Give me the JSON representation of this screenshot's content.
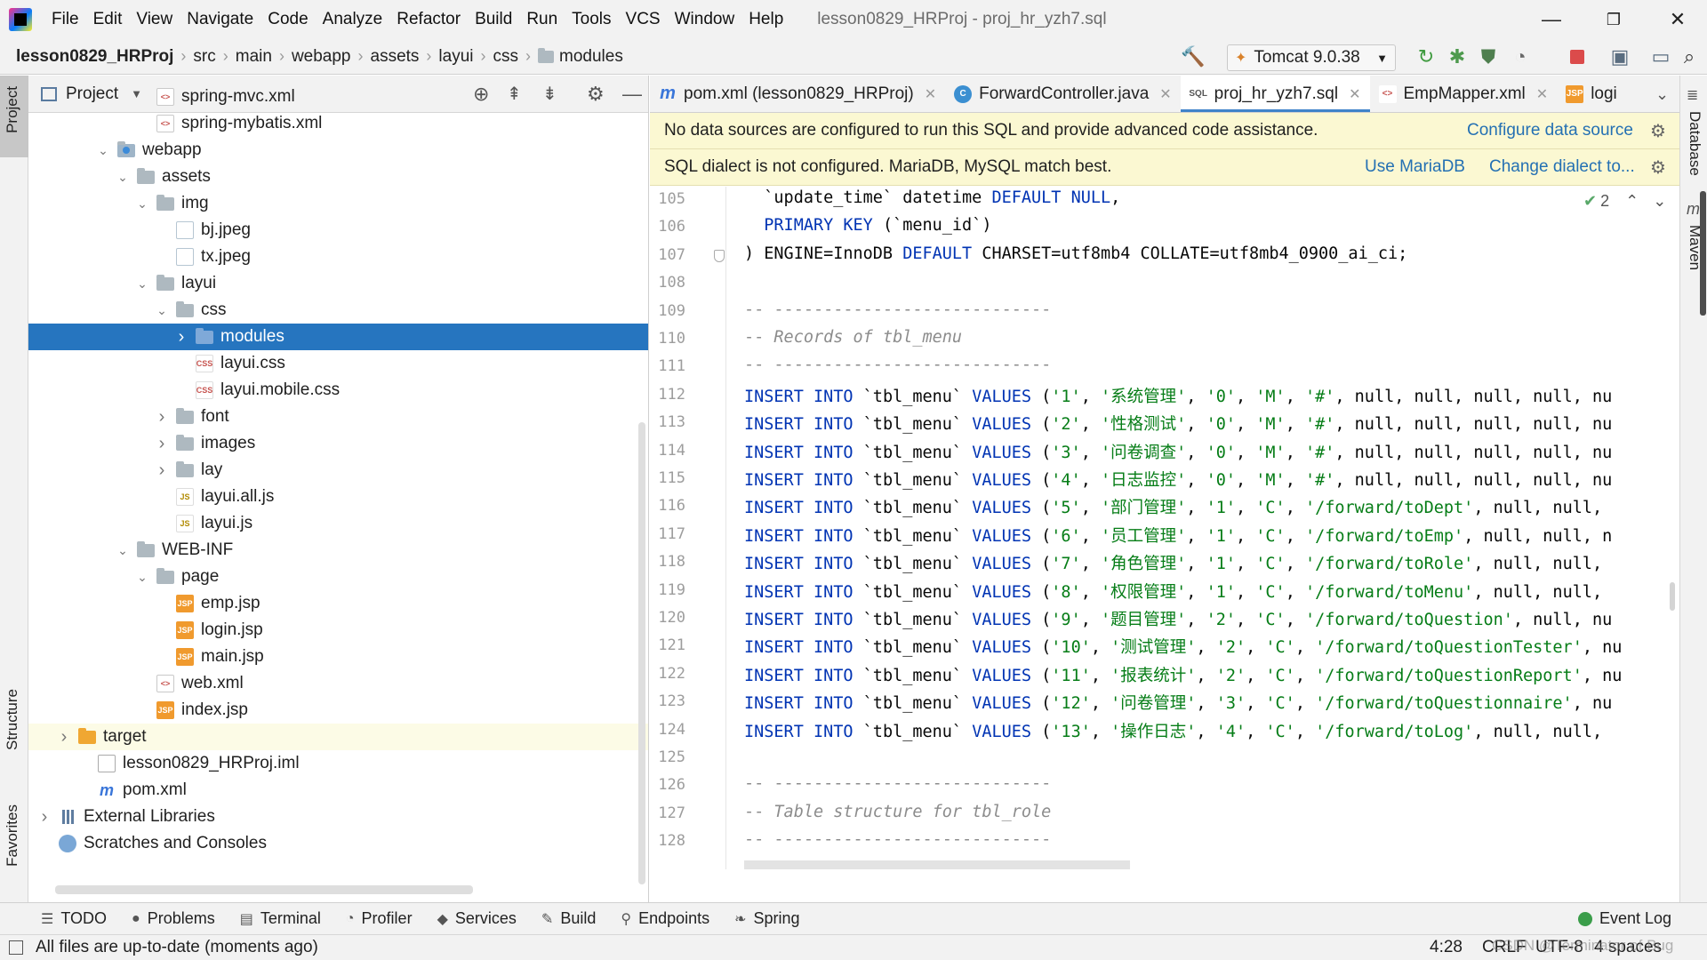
{
  "menubar": {
    "items": [
      "File",
      "Edit",
      "View",
      "Navigate",
      "Code",
      "Analyze",
      "Refactor",
      "Build",
      "Run",
      "Tools",
      "VCS",
      "Window",
      "Help"
    ],
    "title": "lesson0829_HRProj - proj_hr_yzh7.sql",
    "minimize": "—",
    "restore": "❐",
    "close": "✕"
  },
  "navbar": {
    "crumbs": [
      "lesson0829_HRProj",
      "src",
      "main",
      "webapp",
      "assets",
      "layui",
      "css",
      "modules"
    ],
    "run_config": "Tomcat 9.0.38"
  },
  "left_stripe": {
    "project": "Project",
    "structure": "Structure",
    "favorites": "Favorites"
  },
  "right_stripe": {
    "database": "Database",
    "maven": "Maven"
  },
  "project_panel": {
    "title": "Project",
    "tree": [
      {
        "label": "spring-mvc.xml",
        "icon": "xml-file-icon"
      },
      {
        "label": "spring-mybatis.xml",
        "icon": "xml-file-icon"
      },
      {
        "label": "webapp",
        "icon": "webapp-folder-icon",
        "expanded": true
      },
      {
        "label": "assets",
        "icon": "folder-icon",
        "expanded": true
      },
      {
        "label": "img",
        "icon": "folder-icon",
        "expanded": true
      },
      {
        "label": "bj.jpeg",
        "icon": "image-file-icon"
      },
      {
        "label": "tx.jpeg",
        "icon": "image-file-icon"
      },
      {
        "label": "layui",
        "icon": "folder-icon",
        "expanded": true
      },
      {
        "label": "css",
        "icon": "folder-icon",
        "expanded": true
      },
      {
        "label": "modules",
        "icon": "folder-icon",
        "expanded": false,
        "selected": true
      },
      {
        "label": "layui.css",
        "icon": "css-file-icon"
      },
      {
        "label": "layui.mobile.css",
        "icon": "css-file-icon"
      },
      {
        "label": "font",
        "icon": "folder-icon",
        "expanded": false
      },
      {
        "label": "images",
        "icon": "folder-icon",
        "expanded": false
      },
      {
        "label": "lay",
        "icon": "folder-icon",
        "expanded": false
      },
      {
        "label": "layui.all.js",
        "icon": "js-file-icon"
      },
      {
        "label": "layui.js",
        "icon": "js-file-icon"
      },
      {
        "label": "WEB-INF",
        "icon": "folder-icon",
        "expanded": true
      },
      {
        "label": "page",
        "icon": "folder-icon",
        "expanded": true
      },
      {
        "label": "emp.jsp",
        "icon": "jsp-file-icon"
      },
      {
        "label": "login.jsp",
        "icon": "jsp-file-icon"
      },
      {
        "label": "main.jsp",
        "icon": "jsp-file-icon"
      },
      {
        "label": "web.xml",
        "icon": "xml-file-icon"
      },
      {
        "label": "index.jsp",
        "icon": "jsp-file-icon"
      },
      {
        "label": "target",
        "icon": "excluded-folder-icon",
        "expanded": false
      },
      {
        "label": "lesson0829_HRProj.iml",
        "icon": "iml-file-icon"
      },
      {
        "label": "pom.xml",
        "icon": "maven-file-icon"
      },
      {
        "label": "External Libraries",
        "icon": "library-icon",
        "expanded": false
      },
      {
        "label": "Scratches and Consoles",
        "icon": "scratches-icon"
      }
    ]
  },
  "editor_tabs": [
    {
      "label": "pom.xml (lesson0829_HRProj)",
      "icon": "maven-file-icon"
    },
    {
      "label": "ForwardController.java",
      "icon": "java-class-icon"
    },
    {
      "label": "proj_hr_yzh7.sql",
      "icon": "sql-file-icon",
      "active": true
    },
    {
      "label": "EmpMapper.xml",
      "icon": "xml-file-icon"
    },
    {
      "label": "logi",
      "icon": "jsp-file-icon"
    }
  ],
  "banners": {
    "datasource": {
      "text": "No data sources are configured to run this SQL and provide advanced code assistance.",
      "link": "Configure data source"
    },
    "dialect": {
      "text": "SQL dialect is not configured. MariaDB, MySQL match best.",
      "link1": "Use MariaDB",
      "link2": "Change dialect to..."
    }
  },
  "editor": {
    "inspection_count": "2",
    "lines": [
      {
        "n": "105",
        "code": "  `update_time` datetime DEFAULT NULL,"
      },
      {
        "n": "106",
        "code": "  PRIMARY KEY (`menu_id`)"
      },
      {
        "n": "107",
        "code": ") ENGINE=InnoDB DEFAULT CHARSET=utf8mb4 COLLATE=utf8mb4_0900_ai_ci;"
      },
      {
        "n": "108",
        "code": ""
      },
      {
        "n": "109",
        "code": "-- ----------------------------"
      },
      {
        "n": "110",
        "code": "-- Records of tbl_menu"
      },
      {
        "n": "111",
        "code": "-- ----------------------------"
      },
      {
        "n": "112",
        "code": "INSERT INTO `tbl_menu` VALUES ('1', '系统管理', '0', 'M', '#', null, null, null, null, nu"
      },
      {
        "n": "113",
        "code": "INSERT INTO `tbl_menu` VALUES ('2', '性格测试', '0', 'M', '#', null, null, null, null, nu"
      },
      {
        "n": "114",
        "code": "INSERT INTO `tbl_menu` VALUES ('3', '问卷调查', '0', 'M', '#', null, null, null, null, nu"
      },
      {
        "n": "115",
        "code": "INSERT INTO `tbl_menu` VALUES ('4', '日志监控', '0', 'M', '#', null, null, null, null, nu"
      },
      {
        "n": "116",
        "code": "INSERT INTO `tbl_menu` VALUES ('5', '部门管理', '1', 'C', '/forward/toDept', null, null,"
      },
      {
        "n": "117",
        "code": "INSERT INTO `tbl_menu` VALUES ('6', '员工管理', '1', 'C', '/forward/toEmp', null, null, n"
      },
      {
        "n": "118",
        "code": "INSERT INTO `tbl_menu` VALUES ('7', '角色管理', '1', 'C', '/forward/toRole', null, null,"
      },
      {
        "n": "119",
        "code": "INSERT INTO `tbl_menu` VALUES ('8', '权限管理', '1', 'C', '/forward/toMenu', null, null,"
      },
      {
        "n": "120",
        "code": "INSERT INTO `tbl_menu` VALUES ('9', '题目管理', '2', 'C', '/forward/toQuestion', null, nu"
      },
      {
        "n": "121",
        "code": "INSERT INTO `tbl_menu` VALUES ('10', '测试管理', '2', 'C', '/forward/toQuestionTester', nu"
      },
      {
        "n": "122",
        "code": "INSERT INTO `tbl_menu` VALUES ('11', '报表统计', '2', 'C', '/forward/toQuestionReport', nu"
      },
      {
        "n": "123",
        "code": "INSERT INTO `tbl_menu` VALUES ('12', '问卷管理', '3', 'C', '/forward/toQuestionnaire', nu"
      },
      {
        "n": "124",
        "code": "INSERT INTO `tbl_menu` VALUES ('13', '操作日志', '4', 'C', '/forward/toLog', null, null,"
      },
      {
        "n": "125",
        "code": ""
      },
      {
        "n": "126",
        "code": "-- ----------------------------"
      },
      {
        "n": "127",
        "code": "-- Table structure for tbl_role"
      },
      {
        "n": "128",
        "code": "-- ----------------------------"
      }
    ]
  },
  "bottom_tools": [
    "TODO",
    "Problems",
    "Terminal",
    "Profiler",
    "Services",
    "Build",
    "Endpoints",
    "Spring"
  ],
  "event_log": "Event Log",
  "status": {
    "message": "All files are up-to-date (moments ago)",
    "position": "4:28",
    "line_sep": "CRLF",
    "encoding": "UTF-8",
    "indent": "4 spaces",
    "watermark": "CSDN @Terminator of Bug"
  },
  "colors": {
    "selection": "#2675bf",
    "banner": "#fbf8d2",
    "keyword": "#0033b3",
    "string": "#067d17",
    "link": "#2470b3"
  }
}
